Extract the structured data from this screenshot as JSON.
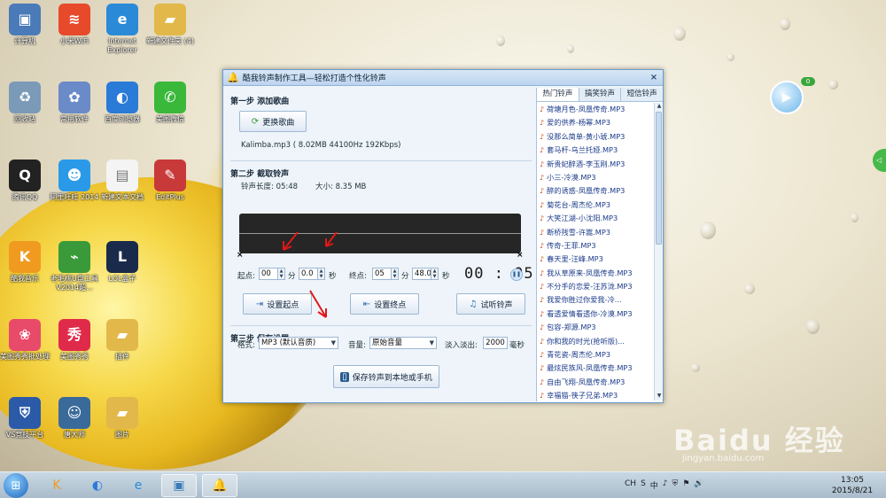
{
  "desktop": {
    "icons": [
      {
        "label": "计算机",
        "icon": "computer-icon",
        "color": "#4a7ab8",
        "glyph": "▣"
      },
      {
        "label": "小米WiFi",
        "icon": "wifi-icon",
        "color": "#e64a2a",
        "glyph": "≋"
      },
      {
        "label": "Internet Explorer",
        "icon": "ie-icon",
        "color": "#2a8ad8",
        "glyph": "e"
      },
      {
        "label": "新建文件夹 (4)",
        "icon": "folder-icon",
        "color": "#e2b84a",
        "glyph": "▰"
      },
      {
        "label": "回收站",
        "icon": "recycle-bin-icon",
        "color": "#7a9ab8",
        "glyph": "♻"
      },
      {
        "label": "常用软件",
        "icon": "app-folder-icon",
        "color": "#6a8ac8",
        "glyph": "✿"
      },
      {
        "label": "百度浏览器",
        "icon": "baidu-browser-icon",
        "color": "#2a7ad8",
        "glyph": "◐"
      },
      {
        "label": "美图微信",
        "icon": "wechat-icon",
        "color": "#3ab83a",
        "glyph": "✆"
      },
      {
        "label": "腾讯QQ",
        "icon": "qq-icon",
        "color": "#222222",
        "glyph": "Q"
      },
      {
        "label": "阿里旺旺 2014",
        "icon": "wangwang-icon",
        "color": "#2a9ae8",
        "glyph": "☻"
      },
      {
        "label": "新建文本文档",
        "icon": "text-document-icon",
        "color": "#f4f4f4",
        "glyph": "▤"
      },
      {
        "label": "EditPlus",
        "icon": "editplus-icon",
        "color": "#c83a3a",
        "glyph": "✎"
      },
      {
        "label": "酷我音乐",
        "icon": "kuwo-music-icon",
        "color": "#f09a20",
        "glyph": "K"
      },
      {
        "label": "老毛桃U盘工具V2014超...",
        "icon": "usb-tool-icon",
        "color": "#3a9a3a",
        "glyph": "⌁"
      },
      {
        "label": "LOL盒子",
        "icon": "lol-box-icon",
        "color": "#1a2a4a",
        "glyph": "L"
      },
      {
        "label": "美图秀秀批处理",
        "icon": "meitu-batch-icon",
        "color": "#e84a6a",
        "glyph": "❀"
      },
      {
        "label": "美图秀秀",
        "icon": "meitu-icon",
        "color": "#e02a4a",
        "glyph": "秀"
      },
      {
        "label": "插件",
        "icon": "plugin-folder-icon",
        "color": "#e2b84a",
        "glyph": "▰"
      },
      {
        "label": "VS竞技平台",
        "icon": "vs-platform-icon",
        "color": "#2a5aa8",
        "glyph": "⛨"
      },
      {
        "label": "唐大师",
        "icon": "tang-master-icon",
        "color": "#3a6a9a",
        "glyph": "☺"
      },
      {
        "label": "图片",
        "icon": "pictures-folder-icon",
        "color": "#e2b84a",
        "glyph": "▰"
      }
    ]
  },
  "window": {
    "title": "酷我铃声制作工具—轻松打造个性化铃声",
    "close": "×",
    "step1": {
      "title": "第一步  添加歌曲",
      "change_button": "更换歌曲",
      "file_info": "Kalimba.mp3  ( 8.02MB 44100Hz  192Kbps)"
    },
    "step2": {
      "title": "第二步  截取铃声",
      "length_label": "铃声长度: 05:48",
      "size_label": "大小: 8.35 MB",
      "start_label": "起点:",
      "start_min": "00",
      "min_unit": "分",
      "start_sec": "0.0",
      "sec_unit": "秒",
      "end_label": "终点:",
      "end_min": "05",
      "end_sec": "48.0",
      "timer": "00 : 05",
      "set_start_button": "设置起点",
      "set_end_button": "设置终点",
      "listen_button": "试听铃声"
    },
    "step3": {
      "title": "第三步  保存设置",
      "format_label": "格式:",
      "format_value": "MP3 (默认音质)",
      "volume_label": "音量:",
      "volume_value": "原始音量",
      "fade_label": "淡入淡出:",
      "fade_value": "2000",
      "fade_unit": "毫秒",
      "save_button": "保存铃声到本地或手机"
    },
    "tabs": [
      "热门铃声",
      "搞笑铃声",
      "短信铃声"
    ],
    "ringtones": [
      "荷塘月色-凤凰传奇.MP3",
      "爱的供养-杨幂.MP3",
      "没那么简单-黄小琥.MP3",
      "套马杆-乌兰托娅.MP3",
      "新贵妃醉酒-李玉刚.MP3",
      "小三-冷漠.MP3",
      "醉的诱惑-凤凰传奇.MP3",
      "菊花台-周杰伦.MP3",
      "大笑江湖-小沈阳.MP3",
      "断桥残雪-许嵩.MP3",
      "传奇-王菲.MP3",
      "春天里-汪峰.MP3",
      "我从草原来-凤凰传奇.MP3",
      "不分手的恋爱-汪苏泷.MP3",
      "我爱你胜过你爱我-冷...",
      "看透爱情看透你-冷漠.MP3",
      "包容-郑源.MP3",
      "你和我的时光(抢听版)...",
      "青花瓷-周杰伦.MP3",
      "最炫民族风-凤凰传奇.MP3",
      "自由飞翔-凤凰传奇.MP3",
      "幸福猫-筷子兄弟.MP3"
    ]
  },
  "overlay": {
    "badge": "0",
    "watermark": "Baidu 经验",
    "watermark_url": "jingyan.baidu.com"
  },
  "taskbar": {
    "tray_text": [
      "CH",
      "S",
      "中",
      "♪",
      "⛨",
      "⚑",
      "🔊"
    ],
    "time": "13:05",
    "date": "2015/8/21"
  }
}
